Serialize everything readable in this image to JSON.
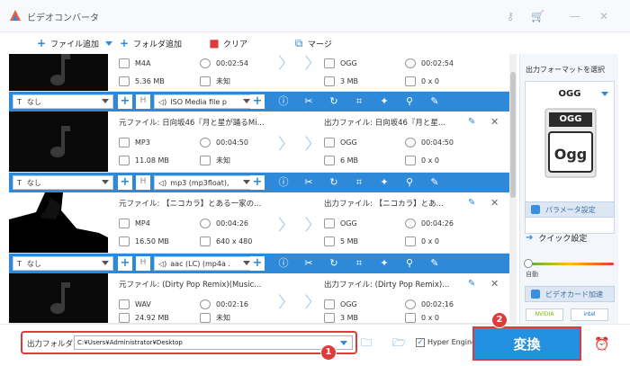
{
  "window": {
    "title": "ビデオコンバータ",
    "controls": [
      "key-icon",
      "cart-icon",
      "minimize-icon",
      "close-icon"
    ]
  },
  "toolbar": {
    "add_file": "ファイル追加",
    "add_folder": "フォルダ追加",
    "clear": "クリア",
    "merge": "マージ"
  },
  "items": [
    {
      "src_name": "",
      "src_format": "M4A",
      "src_duration": "00:02:54",
      "src_size": "5.36 MB",
      "src_res": "未知",
      "out_name": "",
      "out_format": "OGG",
      "out_duration": "00:02:54",
      "out_size": "3 MB",
      "out_res": "0 x 0"
    },
    {
      "src_name": "元ファイル: 日向坂46『月と星が踊るMi...",
      "src_format": "MP3",
      "src_duration": "00:04:50",
      "src_size": "11.08 MB",
      "src_res": "未知",
      "out_name": "出力ファイル: 日向坂46『月と星...",
      "out_format": "OGG",
      "out_duration": "00:04:50",
      "out_size": "6 MB",
      "out_res": "0 x 0"
    },
    {
      "src_name": "元ファイル: 【ニコカラ】とある一家の...",
      "src_format": "MP4",
      "src_duration": "00:04:26",
      "src_size": "16.50 MB",
      "src_res": "640 x 480",
      "out_name": "出力ファイル: 【ニコカラ】とあ...",
      "out_format": "OGG",
      "out_duration": "00:04:26",
      "out_size": "5 MB",
      "out_res": "0 x 0"
    },
    {
      "src_name": "元ファイル: (Dirty Pop Remix)(Music...",
      "src_format": "WAV",
      "src_duration": "00:02:16",
      "src_size": "24.92 MB",
      "src_res": "未知",
      "out_name": "出力ファイル: (Dirty Pop Remix)...",
      "out_format": "OGG",
      "out_duration": "00:02:16",
      "out_size": "3 MB",
      "out_res": "0 x 0"
    }
  ],
  "bars": [
    {
      "subtitle": "なし",
      "audio": "ISO Media file p"
    },
    {
      "subtitle": "なし",
      "audio": "mp3 (mp3float),"
    },
    {
      "subtitle": "なし",
      "audio": "aac (LC) (mp4a ."
    }
  ],
  "right_panel": {
    "title": "出力フォーマットを選択",
    "format": "OGG",
    "format_icon_text": "OGG",
    "params": "パラメータ設定",
    "quick": "クイック設定",
    "auto": "自動",
    "gpu": "ビデオカード加速",
    "nvidia": "NVIDIA",
    "intel": "intel"
  },
  "bottom": {
    "output_folder_label": "出力フォルダ:",
    "output_path": "C:¥Users¥Administrator¥Desktop",
    "hyper_engine": "Hyper Engine",
    "hyper_checked": "✓",
    "convert": "変換",
    "badge1": "1",
    "badge2": "2"
  },
  "colors": {
    "accent": "#2e8ad8",
    "highlight": "#e03b3b",
    "convert_bg": "#2490e0"
  }
}
